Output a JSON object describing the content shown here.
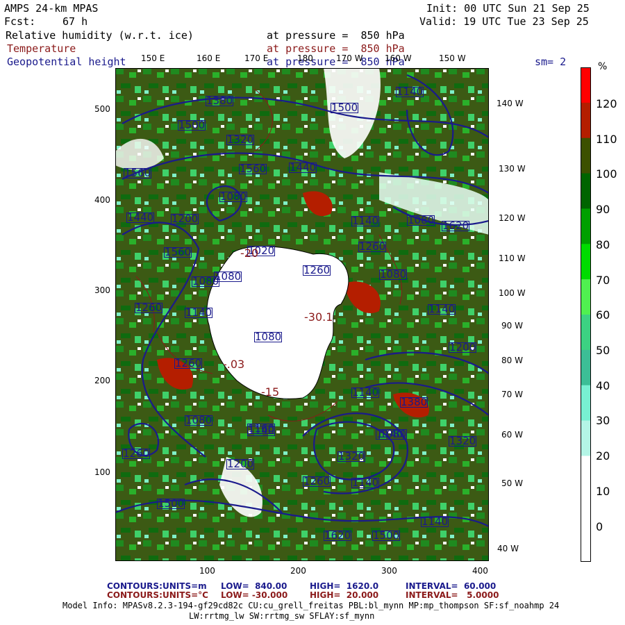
{
  "header": {
    "model": "AMPS 24-km MPAS",
    "fcst_label": "Fcst:",
    "fcst_value": "67 h",
    "init": "Init: 00 UTC Sun 21 Sep 25",
    "valid": "Valid: 19 UTC Tue 23 Sep 25"
  },
  "fields": [
    {
      "name": "Relative humidity (w.r.t. ice)",
      "level": "at pressure =  850 hPa",
      "color": "#000000"
    },
    {
      "name": "Temperature",
      "level": "at pressure =  850 hPa",
      "color": "#8b1a1a"
    },
    {
      "name": "Geopotential height",
      "level": "at pressure =  850 hPa",
      "color": "#1a1a8c"
    }
  ],
  "smoothing": "sm= 2",
  "map": {
    "lon_labels_top": [
      "150 E",
      "160 E",
      "170 E",
      "180",
      "170 W",
      "160 W",
      "150 W"
    ],
    "lon_labels_right": [
      "140 W",
      "130 W",
      "120 W",
      "110 W",
      "100 W",
      "90 W",
      "80 W",
      "70 W",
      "60 W",
      "50 W",
      "40 W"
    ],
    "y_ticks": [
      "500",
      "400",
      "300",
      "200",
      "100"
    ],
    "x_ticks": [
      "100",
      "200",
      "300",
      "400"
    ],
    "height_labels": [
      "1140",
      "1500",
      "1560",
      "1320",
      "1440",
      "1500",
      "1080",
      "1200",
      "1560",
      "1440",
      "1140",
      "1080",
      "1620",
      "1560",
      "1080",
      "1260",
      "1140",
      "1260",
      "1140",
      "1080",
      "1140",
      "1200",
      "1080",
      "1140",
      "1260",
      "1200",
      "1140",
      "1080",
      "1260",
      "1380",
      "1140",
      "1320",
      "1320",
      "1080",
      "1160",
      "1260",
      "1020",
      "1500",
      "1080",
      "1260",
      "1380",
      "1620",
      "1500",
      "1140"
    ],
    "temp_labels": [
      "-30.1",
      "-15",
      "-.03",
      "-20"
    ]
  },
  "colorbar": {
    "unit": "%",
    "labels": [
      "120",
      "110",
      "100",
      "90",
      "80",
      "70",
      "60",
      "50",
      "40",
      "30",
      "20",
      "10",
      "0"
    ],
    "colors": [
      "#ff0000",
      "#b41e00",
      "#3c5000",
      "#006400",
      "#00a000",
      "#00dc00",
      "#50f050",
      "#3cd282",
      "#3cbe96",
      "#78f0d2",
      "#b4f5e6",
      "#ffffff",
      "#ffffff",
      "#ffffff"
    ]
  },
  "footer": {
    "c1_label": "CONTOURS:",
    "c1_units": "UNITS=m",
    "c1_low": "LOW=  840.00",
    "c1_high": "HIGH=  1620.0",
    "c1_interval": "INTERVAL=  60.000",
    "c2_label": "CONTOURS:",
    "c2_units": "UNITS=°C",
    "c2_low": "LOW= -30.000",
    "c2_high": "HIGH=  20.000",
    "c2_interval": "INTERVAL=   5.0000",
    "model_info": "Model Info: MPASv8.2.3-194-gf29cd82c CU:cu_grell_freitas PBL:bl_mynn MP:mp_thompson SF:sf_noahmp 24",
    "model_info2": "LW:rrtmg_lw SW:rrtmg_sw SFLAY:sf_mynn"
  }
}
